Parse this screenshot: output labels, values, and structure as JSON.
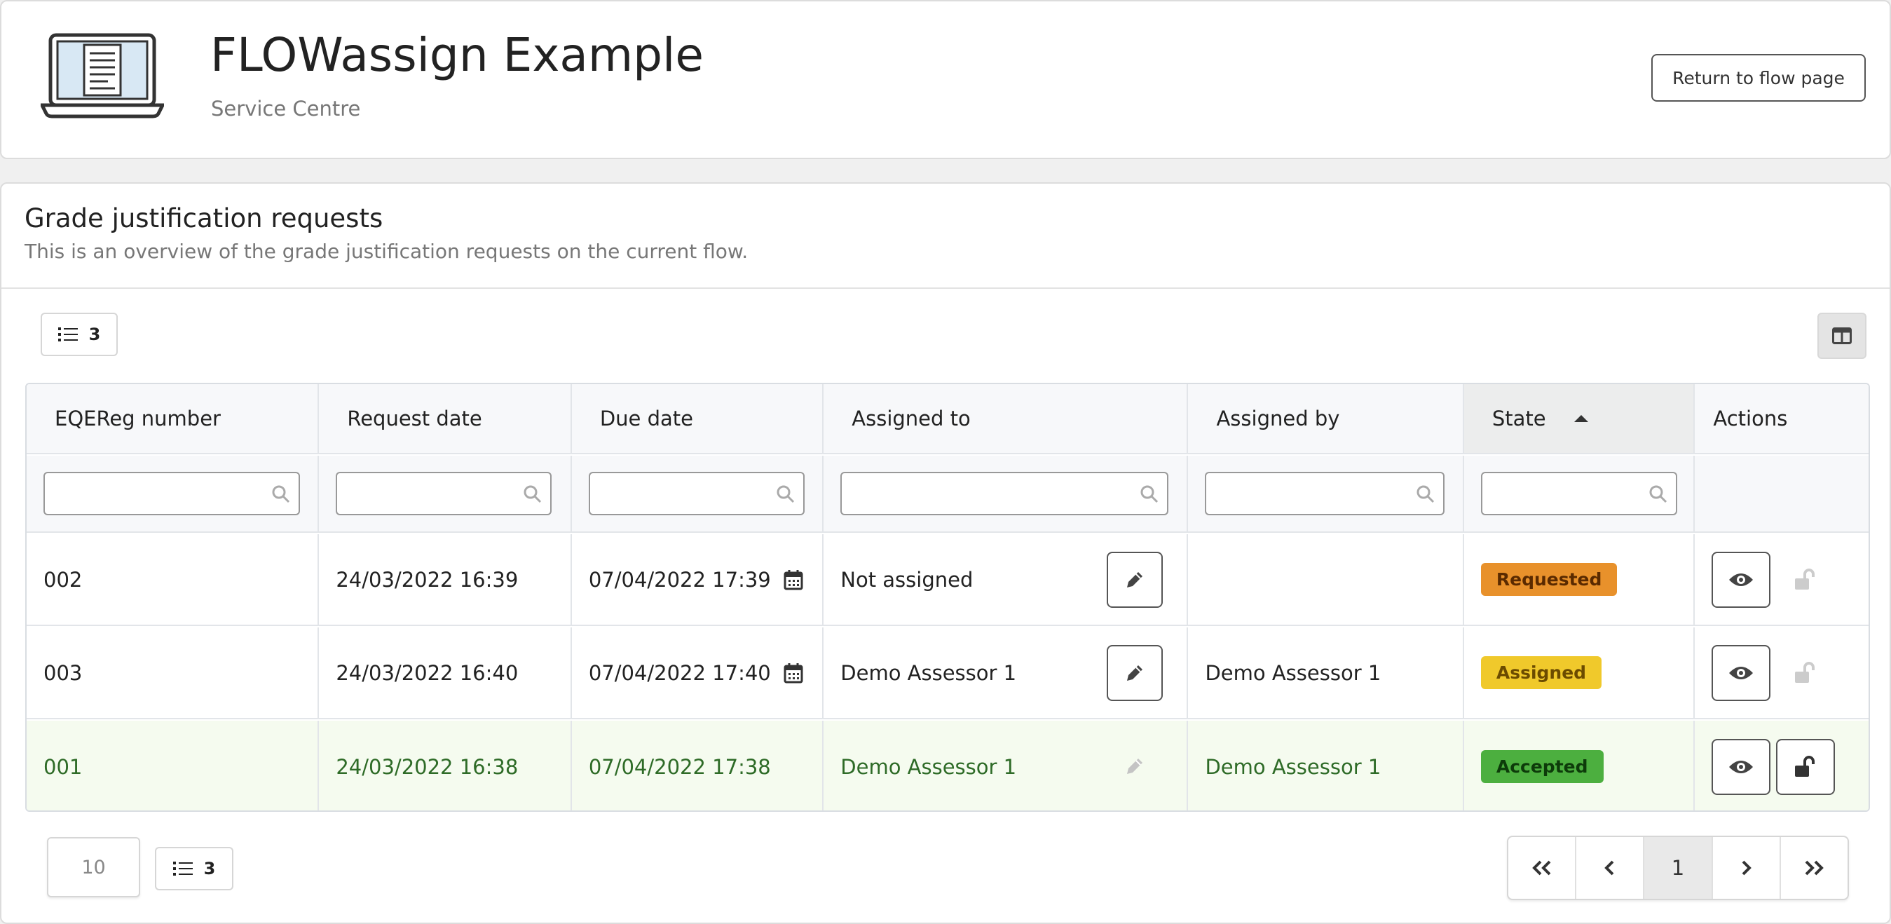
{
  "header": {
    "title": "FLOWassign Example",
    "subtitle": "Service Centre",
    "return_label": "Return to flow page",
    "logo_icon": "laptop-document-icon"
  },
  "section": {
    "title": "Grade justification requests",
    "description": "This is an overview of the grade justification requests on the current flow."
  },
  "toolbar": {
    "row_count": "3",
    "list_icon": "list-icon",
    "columns_icon": "columns-icon"
  },
  "table": {
    "columns": [
      "EQEReg number",
      "Request date",
      "Due date",
      "Assigned to",
      "Assigned by",
      "State",
      "Actions"
    ],
    "sorted_column": "State",
    "sort_direction": "ascending",
    "filters": [
      "",
      "",
      "",
      "",
      "",
      ""
    ],
    "rows": [
      {
        "number": "002",
        "request_date": "24/03/2022 16:39",
        "due_date": "07/04/2022 17:39",
        "assigned_to": "Not assigned",
        "assigned_by": "",
        "state": "Requested"
      },
      {
        "number": "003",
        "request_date": "24/03/2022 16:40",
        "due_date": "07/04/2022 17:40",
        "assigned_to": "Demo Assessor 1",
        "assigned_by": "Demo Assessor 1",
        "state": "Assigned"
      },
      {
        "number": "001",
        "request_date": "24/03/2022 16:38",
        "due_date": "07/04/2022 17:38",
        "assigned_to": "Demo Assessor 1",
        "assigned_by": "Demo Assessor 1",
        "state": "Accepted"
      }
    ]
  },
  "state_colors": {
    "Requested": "#e8912b",
    "Assigned": "#f0c92b",
    "Accepted": "#4caf3f"
  },
  "accepted_row_color": "#f5fbef",
  "footer": {
    "page_size": "10",
    "total_count": "3",
    "pagination": {
      "first": "«",
      "prev": "‹",
      "current": "1",
      "next": "›",
      "last": "»"
    }
  }
}
